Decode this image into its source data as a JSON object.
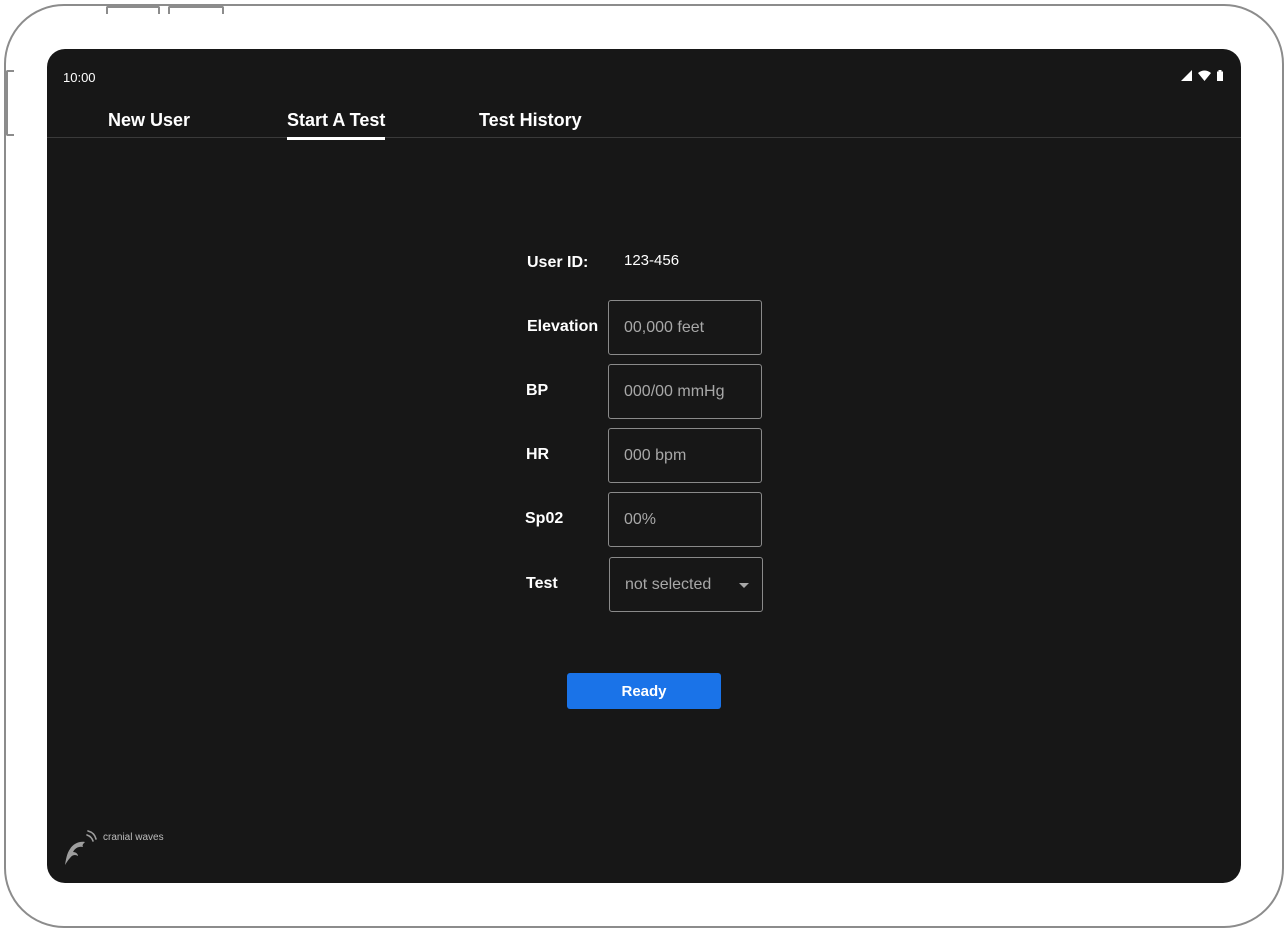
{
  "status_bar": {
    "time": "10:00",
    "icons": [
      "signal-icon",
      "wifi-icon",
      "battery-icon"
    ]
  },
  "tabs": [
    {
      "label": "New User",
      "active": false
    },
    {
      "label": "Start A Test",
      "active": true
    },
    {
      "label": "Test History",
      "active": false
    }
  ],
  "form": {
    "user_id_label": "User ID:",
    "user_id_value": "123-456",
    "elevation": {
      "label": "Elevation",
      "value": "",
      "placeholder": "00,000 feet"
    },
    "bp": {
      "label": "BP",
      "value": "",
      "placeholder": "000/00 mmHg"
    },
    "hr": {
      "label": "HR",
      "value": "",
      "placeholder": "000 bpm"
    },
    "spo2": {
      "label": "Sp02",
      "value": "",
      "placeholder": "00%"
    },
    "test": {
      "label": "Test",
      "selected": "not selected"
    }
  },
  "ready_button": {
    "label": "Ready"
  },
  "logo": {
    "text": "cranial waves",
    "icon": "dolphin-icon"
  },
  "colors": {
    "screen_bg": "#171717",
    "accent": "#1a73e8",
    "text": "#ffffff",
    "placeholder": "#a8a8a8",
    "field_border": "#8a8a8a"
  }
}
